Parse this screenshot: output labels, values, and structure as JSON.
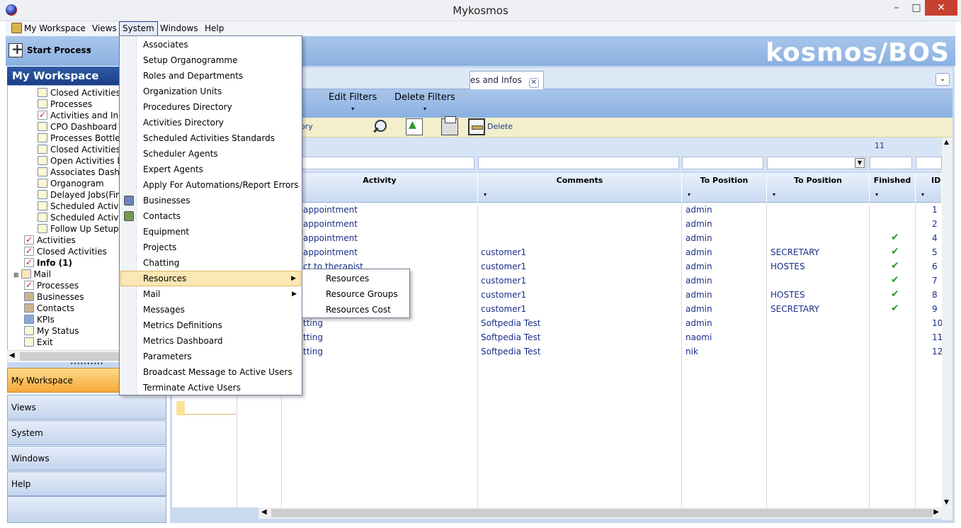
{
  "window": {
    "title": "Mykosmos",
    "minimize": "–",
    "maximize": "□",
    "close": "✕"
  },
  "menubar": {
    "items": [
      "My Workspace",
      "Views",
      "System",
      "Windows",
      "Help"
    ]
  },
  "toolbar": {
    "start_process": "Start Process",
    "start_arrow": "▸",
    "brand": "kosmos/BOS"
  },
  "workspace": {
    "header": "My Workspace",
    "tree": [
      "Closed Activities",
      "Processes",
      "Activities and In",
      "CPO Dashboard",
      "Processes Bottle",
      "Closed Activities",
      "Open Activities D",
      "Associates Dash",
      "Organogram",
      "Delayed Jobs(Fir",
      "Scheduled Activi",
      "Scheduled Activi",
      "Follow Up Setup",
      "Activities",
      "Closed Activities",
      "Info (1)",
      "Mail",
      "Processes",
      "Businesses",
      "Contacts",
      "KPIs",
      "My Status",
      "Exit"
    ],
    "splitter": "••••••••••",
    "nav": [
      "My Workspace",
      "Views",
      "System",
      "Windows",
      "Help"
    ]
  },
  "tab": {
    "label": "es and Infos",
    "close": "✕",
    "chevron": "⌄"
  },
  "filters": {
    "edit": "Edit Filters",
    "delete": "Delete Filters",
    "caret": "▾"
  },
  "actions": {
    "history": "ory",
    "delete": "Delete"
  },
  "grid": {
    "count": "11",
    "columns": [
      "Activity",
      "Comments",
      "To Position",
      "To Position",
      "Finished",
      "ID"
    ],
    "caret": "▾",
    "rows": [
      {
        "activity": "appointment",
        "comments": "",
        "to_position1": "admin",
        "to_position2": "",
        "finished": "",
        "id": "1"
      },
      {
        "activity": "appointment",
        "comments": "",
        "to_position1": "admin",
        "to_position2": "",
        "finished": "",
        "id": "2"
      },
      {
        "activity": "appointment",
        "comments": "",
        "to_position1": "admin",
        "to_position2": "",
        "finished": "✔",
        "id": "4"
      },
      {
        "activity": "appointment",
        "comments": "customer1",
        "to_position1": "admin",
        "to_position2": "SECRETARY",
        "finished": "✔",
        "id": "5"
      },
      {
        "activity": "ct to therapist",
        "comments": "customer1",
        "to_position1": "admin",
        "to_position2": "HOSTES",
        "finished": "✔",
        "id": "6"
      },
      {
        "activity": "",
        "comments": "customer1",
        "to_position1": "admin",
        "to_position2": "",
        "finished": "✔",
        "id": "7"
      },
      {
        "activity": "",
        "comments": "customer1",
        "to_position1": "admin",
        "to_position2": "HOSTES",
        "finished": "✔",
        "id": "8"
      },
      {
        "activity": "",
        "comments": "customer1",
        "to_position1": "admin",
        "to_position2": "SECRETARY",
        "finished": "✔",
        "id": "9"
      },
      {
        "activity": "tting",
        "comments": "Softpedia Test",
        "to_position1": "admin",
        "to_position2": "",
        "finished": "",
        "id": "10"
      },
      {
        "activity": "tting",
        "comments": "Softpedia Test",
        "to_position1": "naomi",
        "to_position2": "",
        "finished": "",
        "id": "11"
      },
      {
        "activity": "tting",
        "comments": "Softpedia Test",
        "to_position1": "nik",
        "to_position2": "",
        "finished": "",
        "id": "12"
      }
    ]
  },
  "system_menu": {
    "items": [
      "Associates",
      "Setup Organogramme",
      "Roles and Departments",
      "Organization Units",
      "Procedures Directory",
      "Activities Directory",
      "Scheduled Activities Standards",
      "Scheduler Agents",
      "Expert Agents",
      "Apply For Automations/Report Errors",
      "Businesses",
      "Contacts",
      "Equipment",
      "Projects",
      "Chatting",
      "Resources",
      "Mail",
      "Messages",
      "Metrics Definitions",
      "Metrics Dashboard",
      "Parameters",
      "Broadcast Message to Active Users",
      "Terminate Active Users"
    ],
    "submenu_arrow": "▶"
  },
  "resources_submenu": {
    "items": [
      "Resources",
      "Resource Groups",
      "Resources Cost"
    ]
  },
  "scroll": {
    "up": "▲",
    "down": "▼",
    "left": "◀",
    "right": "▶"
  }
}
